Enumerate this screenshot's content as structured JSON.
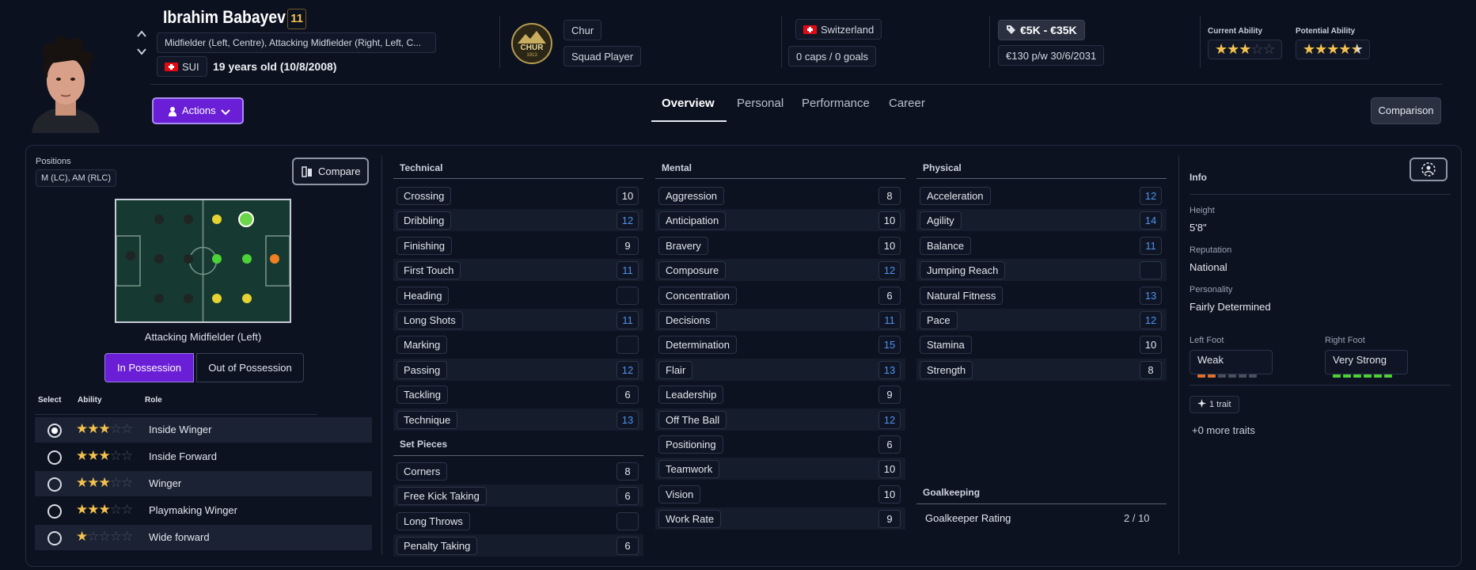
{
  "player": {
    "name": "Ibrahim Babayev",
    "number": "11",
    "positions": "Midfielder (Left, Centre), Attacking Midfielder (Right, Left, C...",
    "nation_code": "SUI",
    "age": "19 years old (10/8/2008)"
  },
  "club": {
    "badge_text": "CHUR",
    "badge_year": "1913",
    "name": "Chur",
    "status": "Squad Player"
  },
  "nation": {
    "country": "Switzerland",
    "caps": "0 caps / 0 goals"
  },
  "contract": {
    "value": "€5K - €35K",
    "wage": "€130 p/w",
    "expiry": "30/6/2031"
  },
  "ability": {
    "current_label": "Current Ability",
    "current_stars": 3,
    "potential_label": "Potential Ability",
    "potential_stars": 4.5
  },
  "actions_label": "Actions",
  "tabs": [
    "Overview",
    "Personal",
    "Performance",
    "Career"
  ],
  "comparison_label": "Comparison",
  "positions": {
    "label": "Positions",
    "value": "M (LC), AM (RLC)",
    "compare_label": "Compare",
    "role_position": "Attacking Midfielder (Left)",
    "in_possession": "In Possession",
    "out_possession": "Out of Possession"
  },
  "roles_header": {
    "select": "Select",
    "ability": "Ability",
    "role": "Role"
  },
  "roles": [
    {
      "name": "Inside Winger",
      "stars": 3,
      "selected": true
    },
    {
      "name": "Inside Forward",
      "stars": 3,
      "selected": false
    },
    {
      "name": "Winger",
      "stars": 3,
      "selected": false
    },
    {
      "name": "Playmaking Winger",
      "stars": 3,
      "selected": false
    },
    {
      "name": "Wide forward",
      "stars": 1,
      "selected": false
    }
  ],
  "technical": {
    "title": "Technical",
    "attrs": [
      {
        "name": "Crossing",
        "value": "10",
        "blue": false
      },
      {
        "name": "Dribbling",
        "value": "12",
        "blue": true
      },
      {
        "name": "Finishing",
        "value": "9",
        "blue": false
      },
      {
        "name": "First Touch",
        "value": "11",
        "blue": true
      },
      {
        "name": "Heading",
        "value": "",
        "blue": false
      },
      {
        "name": "Long Shots",
        "value": "11",
        "blue": true
      },
      {
        "name": "Marking",
        "value": "",
        "blue": false
      },
      {
        "name": "Passing",
        "value": "12",
        "blue": true
      },
      {
        "name": "Tackling",
        "value": "6",
        "blue": false
      },
      {
        "name": "Technique",
        "value": "13",
        "blue": true
      }
    ]
  },
  "set_pieces": {
    "title": "Set Pieces",
    "attrs": [
      {
        "name": "Corners",
        "value": "8",
        "blue": false
      },
      {
        "name": "Free Kick Taking",
        "value": "6",
        "blue": false
      },
      {
        "name": "Long Throws",
        "value": "",
        "blue": false
      },
      {
        "name": "Penalty Taking",
        "value": "6",
        "blue": false
      }
    ]
  },
  "mental": {
    "title": "Mental",
    "attrs": [
      {
        "name": "Aggression",
        "value": "8",
        "blue": false
      },
      {
        "name": "Anticipation",
        "value": "10",
        "blue": false
      },
      {
        "name": "Bravery",
        "value": "10",
        "blue": false
      },
      {
        "name": "Composure",
        "value": "12",
        "blue": true
      },
      {
        "name": "Concentration",
        "value": "6",
        "blue": false
      },
      {
        "name": "Decisions",
        "value": "11",
        "blue": true
      },
      {
        "name": "Determination",
        "value": "15",
        "blue": true
      },
      {
        "name": "Flair",
        "value": "13",
        "blue": true
      },
      {
        "name": "Leadership",
        "value": "9",
        "blue": false
      },
      {
        "name": "Off The Ball",
        "value": "12",
        "blue": true
      },
      {
        "name": "Positioning",
        "value": "6",
        "blue": false
      },
      {
        "name": "Teamwork",
        "value": "10",
        "blue": false
      },
      {
        "name": "Vision",
        "value": "10",
        "blue": false
      },
      {
        "name": "Work Rate",
        "value": "9",
        "blue": false
      }
    ]
  },
  "physical": {
    "title": "Physical",
    "attrs": [
      {
        "name": "Acceleration",
        "value": "12",
        "blue": true
      },
      {
        "name": "Agility",
        "value": "14",
        "blue": true
      },
      {
        "name": "Balance",
        "value": "11",
        "blue": true
      },
      {
        "name": "Jumping Reach",
        "value": "",
        "blue": false
      },
      {
        "name": "Natural Fitness",
        "value": "13",
        "blue": true
      },
      {
        "name": "Pace",
        "value": "12",
        "blue": true
      },
      {
        "name": "Stamina",
        "value": "10",
        "blue": false
      },
      {
        "name": "Strength",
        "value": "8",
        "blue": false
      }
    ]
  },
  "goalkeeping": {
    "title": "Goalkeeping",
    "rating_label": "Goalkeeper Rating",
    "rating_value": "2 / 10"
  },
  "info": {
    "title": "Info",
    "height_label": "Height",
    "height": "5'8\"",
    "reputation_label": "Reputation",
    "reputation": "National",
    "personality_label": "Personality",
    "personality": "Fairly Determined",
    "left_foot_label": "Left Foot",
    "left_foot": "Weak",
    "left_foot_level": 2,
    "right_foot_label": "Right Foot",
    "right_foot": "Very Strong",
    "right_foot_level": 6,
    "traits": "1 trait",
    "more_traits": "+0 more traits"
  },
  "colors": {
    "accent": "#6a1fd6",
    "stat_blue": "#4f93ee",
    "star": "#f2c14e",
    "pitch": "#163a31",
    "foot_weak": "#e0702a",
    "foot_strong": "#4cd137"
  },
  "icons": [
    "chevron-up-icon",
    "chevron-down-icon",
    "person-icon",
    "tag-icon",
    "compare-icon",
    "sparkle-icon",
    "settings-icon"
  ]
}
